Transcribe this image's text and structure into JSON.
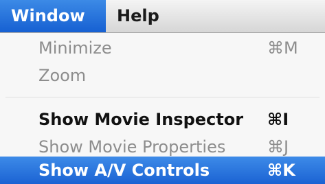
{
  "menubar": {
    "items": [
      {
        "label": "Window"
      },
      {
        "label": "Help"
      }
    ]
  },
  "menu": {
    "items": [
      {
        "label": "Minimize",
        "shortcut": "⌘M",
        "state": "disabled"
      },
      {
        "label": "Zoom",
        "shortcut": "",
        "state": "disabled"
      },
      {
        "label": "Show Movie Inspector",
        "shortcut": "⌘I",
        "state": "enabled"
      },
      {
        "label": "Show Movie Properties",
        "shortcut": "⌘J",
        "state": "disabled"
      },
      {
        "label": "Show A/V Controls",
        "shortcut": "⌘K",
        "state": "highlighted"
      }
    ]
  },
  "colors": {
    "highlight": "#1b62d3",
    "disabled_text": "#8d8d8d",
    "menu_background": "#f7f7f7"
  }
}
